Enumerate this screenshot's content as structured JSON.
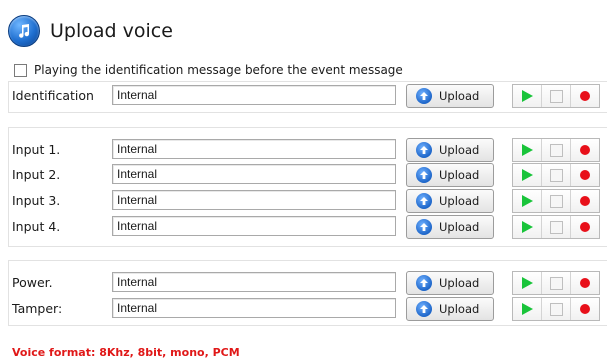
{
  "header": {
    "title": "Upload voice",
    "icon": "music-note-icon"
  },
  "identification_checkbox": {
    "label": "Playing the identification message before the event message",
    "checked": false
  },
  "rows": {
    "identification": {
      "label": "Identification",
      "value": "Internal",
      "upload_label": "Upload"
    },
    "input1": {
      "label": "Input 1.",
      "value": "Internal",
      "upload_label": "Upload"
    },
    "input2": {
      "label": "Input 2.",
      "value": "Internal",
      "upload_label": "Upload"
    },
    "input3": {
      "label": "Input 3.",
      "value": "Internal",
      "upload_label": "Upload"
    },
    "input4": {
      "label": "Input 4.",
      "value": "Internal",
      "upload_label": "Upload"
    },
    "power": {
      "label": "Power.",
      "value": "Internal",
      "upload_label": "Upload"
    },
    "tamper": {
      "label": "Tamper:",
      "value": "Internal",
      "upload_label": "Upload"
    }
  },
  "controls": {
    "play_icon": "play-icon",
    "stop_icon": "stop-icon",
    "record_icon": "record-icon",
    "play_color": "#19c43a",
    "record_color": "#e8101a"
  },
  "footer": {
    "text": "Voice format: 8Khz, 8bit, mono, PCM",
    "color": "#e01818"
  }
}
